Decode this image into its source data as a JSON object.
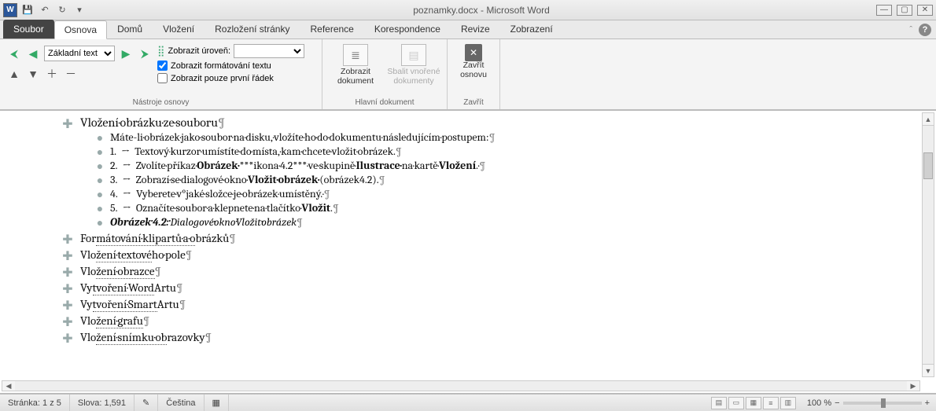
{
  "title": "poznamky.docx - Microsoft Word",
  "tabs": {
    "file": "Soubor",
    "items": [
      "Osnova",
      "Domů",
      "Vložení",
      "Rozložení stránky",
      "Reference",
      "Korespondence",
      "Revize",
      "Zobrazení"
    ],
    "active": 0
  },
  "ribbon": {
    "outline_tools": {
      "level_value": "Základní text",
      "show_level_label": "Zobrazit úroveň:",
      "show_formatting": "Zobrazit formátování textu",
      "show_first_line": "Zobrazit pouze první řádek",
      "group_label": "Nástroje osnovy"
    },
    "master": {
      "show_doc": "Zobrazit dokument",
      "collapse": "Sbalit vnořené dokumenty",
      "group_label": "Hlavní dokument"
    },
    "close": {
      "label": "Zavřít osnovu",
      "group_label": "Zavřít"
    }
  },
  "doc": {
    "h1": "Vložení·obrázku·ze·souboru",
    "intro": "Máte-li·obrázek·jako·soubor·na·disku,·vložíte·ho·do·dokumentu·následujícím·postupem:",
    "s1": "Textový·kurzor·umístíte·do·místa,·kam·chcete·vložit·obrázek.",
    "s2a": "Zvolíte·příkaz·",
    "s2b": "Obrázek·",
    "s2c": "***ikona·4.2***·ve·skupině·",
    "s2d": "Ilustrace·",
    "s2e": "na·kartě·",
    "s2f": "Vložení",
    "s3a": "Zobrazí·se·dialogové·okno·",
    "s3b": "Vložit·obrázek·",
    "s3c": "(obrázek4.2).",
    "s4": "Vyberete·v°jaké·složce·je·obrázek·umístěný.·",
    "s5a": "Označíte·soubor·a·klepnete·na·tlačítko·",
    "s5b": "Vložit",
    "captiona": "Obrázek·4.2:·",
    "captionb": "Dialogové·okno·Vložit·obrázek",
    "h2": [
      {
        "pre": "For",
        "u": "mátování·klipartů·a·o",
        "post": "brázků"
      },
      {
        "pre": "Vlo",
        "u": "žení·textové",
        "post": "ho·pole"
      },
      {
        "pre": "Vlo",
        "u": "žení·obrazce",
        "post": ""
      },
      {
        "pre": "Vy",
        "u": "tvoření·Word",
        "post": "Artu"
      },
      {
        "pre": "Vy",
        "u": "tvoření·Smart",
        "post": "Artu"
      },
      {
        "pre": "Vlo",
        "u": "žení·grafu",
        "post": ""
      },
      {
        "pre": "Vlo",
        "u": "žení·snímku·ob",
        "post": "razovky"
      }
    ]
  },
  "status": {
    "page": "Stránka: 1 z 5",
    "words": "Slova: 1,591",
    "lang": "Čeština",
    "zoom": "100 %"
  }
}
